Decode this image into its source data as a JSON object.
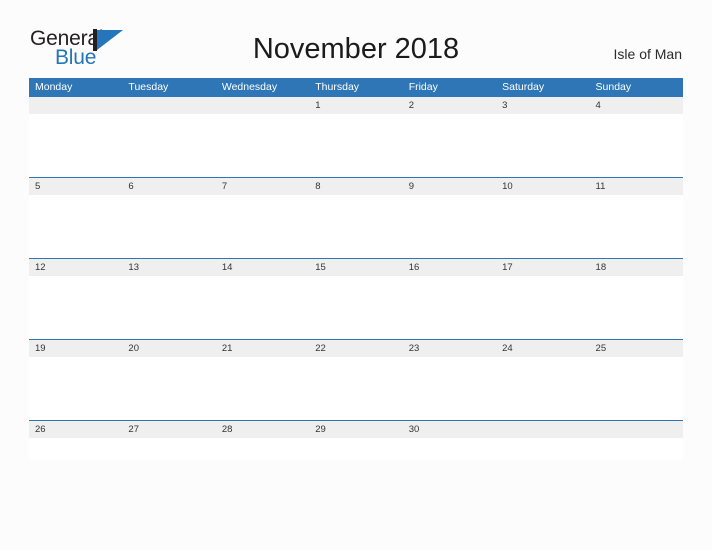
{
  "brand": {
    "name_part1": "General",
    "name_part2": "Blue",
    "mark": "flag-triangle-icon",
    "accent_color": "#2575bb"
  },
  "header": {
    "title": "November 2018",
    "location": "Isle of Man"
  },
  "colors": {
    "header_blue": "#2e76b6",
    "date_band_gray": "#efefef",
    "page_background": "#fcfcfc"
  },
  "calendar": {
    "month": "November",
    "year": "2018",
    "weekday_headers": [
      "Monday",
      "Tuesday",
      "Wednesday",
      "Thursday",
      "Friday",
      "Saturday",
      "Sunday"
    ],
    "weeks": [
      {
        "days": [
          "",
          "",
          "",
          "1",
          "2",
          "3",
          "4"
        ]
      },
      {
        "days": [
          "5",
          "6",
          "7",
          "8",
          "9",
          "10",
          "11"
        ]
      },
      {
        "days": [
          "12",
          "13",
          "14",
          "15",
          "16",
          "17",
          "18"
        ]
      },
      {
        "days": [
          "19",
          "20",
          "21",
          "22",
          "23",
          "24",
          "25"
        ]
      },
      {
        "days": [
          "26",
          "27",
          "28",
          "29",
          "30",
          "",
          ""
        ]
      }
    ]
  }
}
